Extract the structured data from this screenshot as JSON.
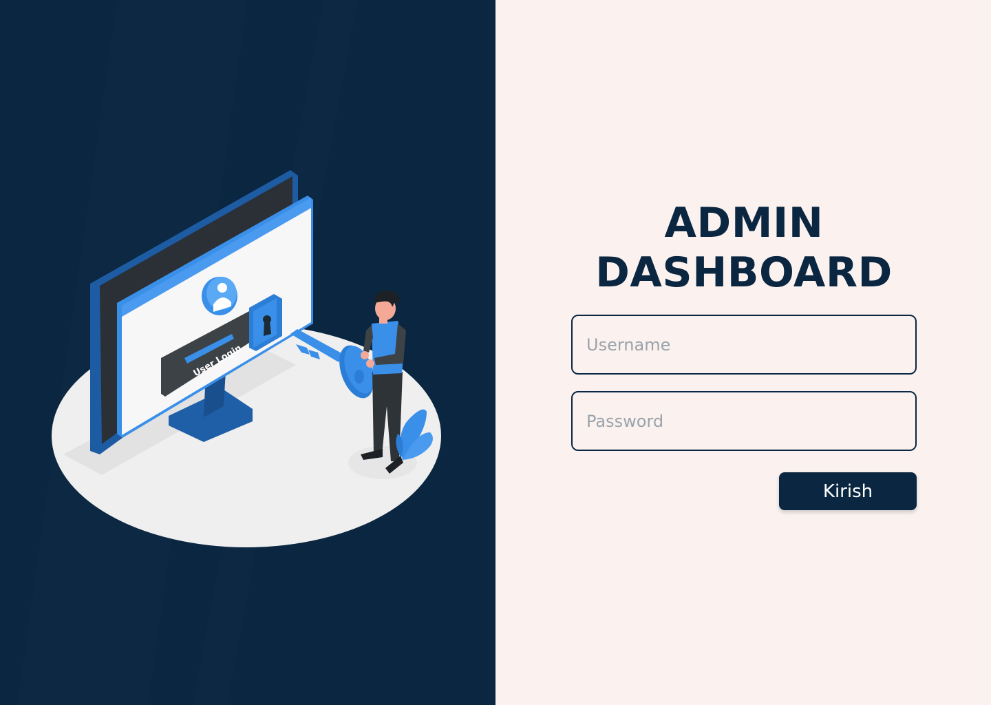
{
  "colors": {
    "brand": "#0a2640",
    "left_background": "#0a2640",
    "right_background": "#fbf2f0",
    "accent_blue": "#3a8fe8",
    "placeholder": "#9aa3ab"
  },
  "illustration": {
    "screen_label": "User Login",
    "icons": [
      "monitor-icon",
      "user-avatar-icon",
      "keyhole-icon",
      "key-icon",
      "person-figure",
      "plant-icon"
    ]
  },
  "login": {
    "title_line1": "ADMIN",
    "title_line2": "DASHBOARD",
    "username_placeholder": "Username",
    "password_placeholder": "Password",
    "submit_label": "Kirish"
  }
}
